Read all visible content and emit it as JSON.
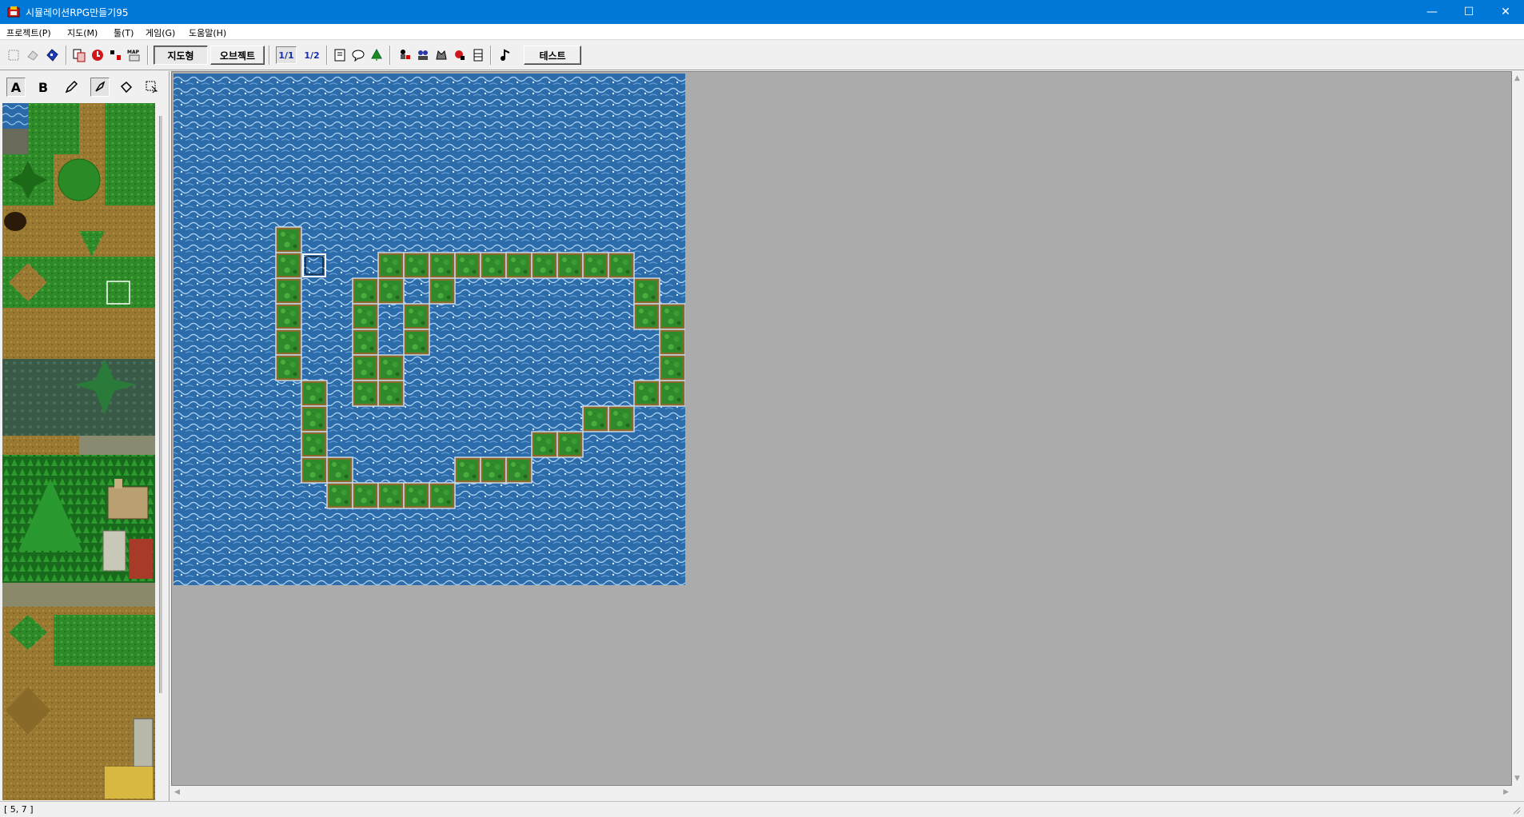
{
  "window": {
    "title": "시뮬레이션RPG만들기95",
    "minimize": "—",
    "maximize": "☐",
    "close": "✕"
  },
  "menu": [
    {
      "label": "프로젝트(P)"
    },
    {
      "label": "지도(M)"
    },
    {
      "label": "툴(T)"
    },
    {
      "label": "게임(G)"
    },
    {
      "label": "도움말(H)"
    }
  ],
  "toolbar": {
    "map_button": "지도형",
    "object_button": "오브젝트",
    "scale_full": "1/1",
    "scale_half": "1/2",
    "test_button": "테스트"
  },
  "palette": {
    "tool_a": "A",
    "tool_b": "B"
  },
  "status": {
    "coord": "[ 5, 7 ]"
  },
  "colors": {
    "titlebar": "#0078d7",
    "water": "#2a6aa8",
    "grass": "#2f8a2a",
    "dirt": "#9a7a32",
    "workspace": "#ababab"
  }
}
